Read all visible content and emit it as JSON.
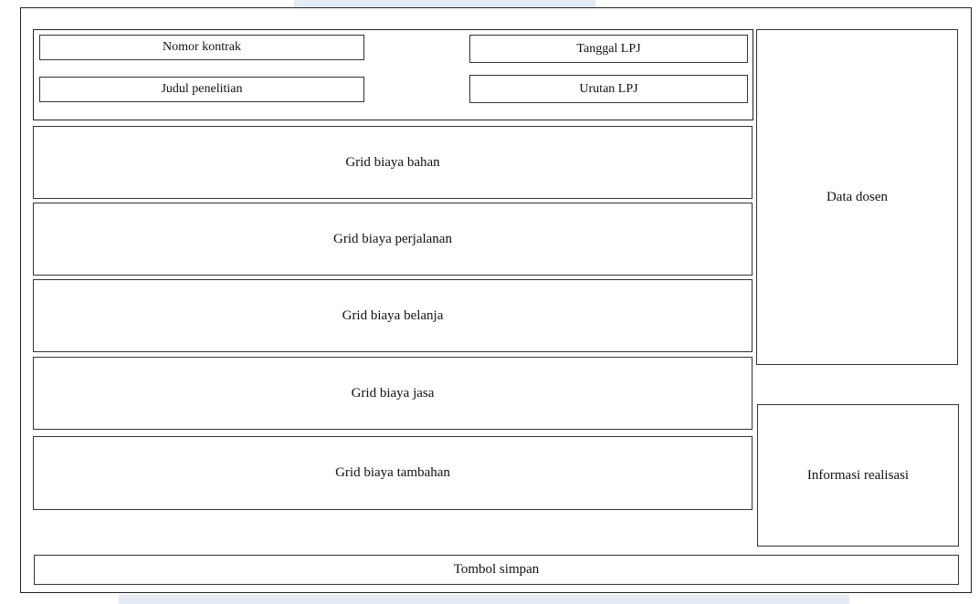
{
  "header_fields": {
    "nomor_kontrak": "Nomor kontrak",
    "tanggal_lpj": "Tanggal LPJ",
    "judul_penelitian": "Judul penelitian",
    "urutan_lpj": "Urutan LPJ"
  },
  "grids": [
    {
      "label": "Grid biaya bahan"
    },
    {
      "label": "Grid biaya perjalanan"
    },
    {
      "label": "Grid biaya belanja"
    },
    {
      "label": "Grid biaya jasa"
    },
    {
      "label": "Grid biaya tambahan"
    }
  ],
  "side_panels": {
    "data_dosen": "Data dosen",
    "informasi_realisasi": "Informasi realisasi"
  },
  "footer": {
    "save_button": "Tombol simpan"
  },
  "colors": {
    "border": "#333333",
    "watermark": "#e3ebf5"
  }
}
